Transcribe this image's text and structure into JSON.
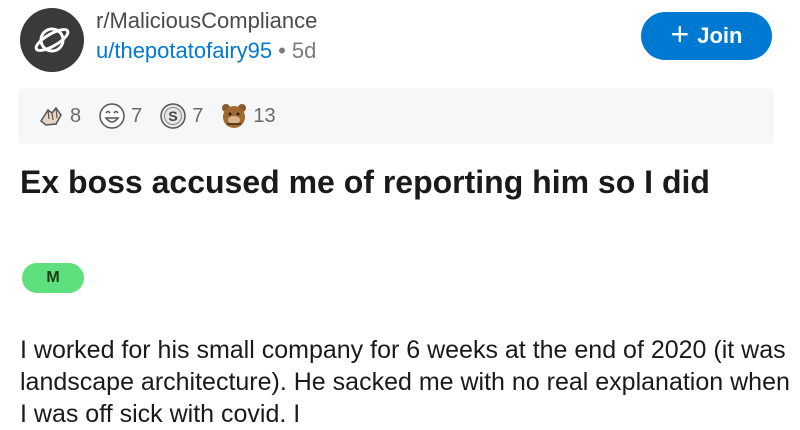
{
  "header": {
    "subreddit": "r/MaliciousCompliance",
    "username": "u/thepotatofairy95",
    "separator": "•",
    "age": "5d",
    "join_label": "Join",
    "join_icon": "plus-icon"
  },
  "awards": [
    {
      "icon": "hands-award-icon",
      "count": "8"
    },
    {
      "icon": "laughing-face-award-icon",
      "count": "7"
    },
    {
      "icon": "silver-award-icon",
      "count": "7"
    },
    {
      "icon": "bear-award-icon",
      "count": "13"
    }
  ],
  "post": {
    "title": "Ex boss accused me of reporting him so I did",
    "flair": "M",
    "body": "I worked for his small company for 6 weeks at the end of 2020 (it was landscape architecture). He sacked me with no real explanation when I was off sick with covid. I"
  },
  "colors": {
    "accent": "#0079d3",
    "flair_bg": "#5de07d",
    "awards_bg": "#f6f7f8"
  }
}
